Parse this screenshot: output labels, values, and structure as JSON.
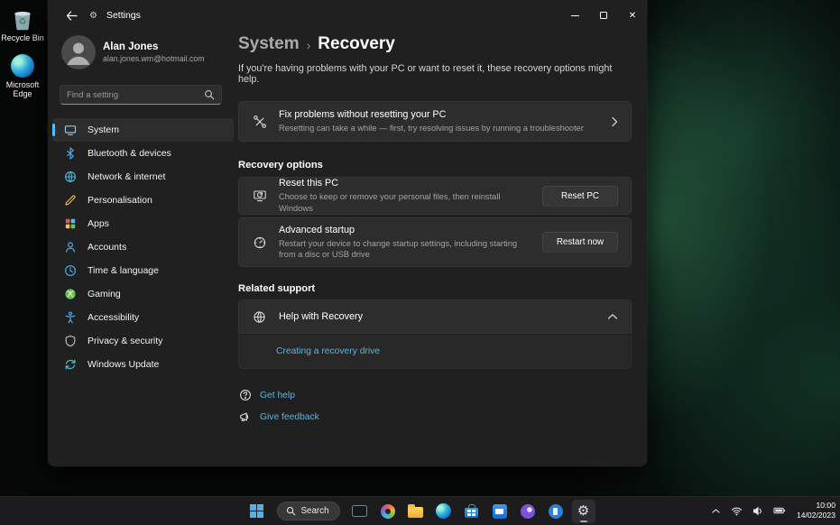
{
  "colors": {
    "accent": "#4cc2ff",
    "link": "#5fb4dc",
    "window_bg": "#202020",
    "card_bg": "#2d2d2d",
    "taskbar_bg": "#1d1d1f"
  },
  "desktop": {
    "icons": [
      {
        "label": "Recycle Bin",
        "icon": "recycle-bin-icon"
      },
      {
        "label": "Microsoft Edge",
        "icon": "edge-icon"
      }
    ]
  },
  "window": {
    "title": "Settings",
    "controls": {
      "minimize": "minimize",
      "maximize": "maximize",
      "close": "close"
    },
    "user": {
      "name": "Alan Jones",
      "email": "alan.jones.wm@hotmail.com"
    },
    "search": {
      "placeholder": "Find a setting",
      "icon": "search-icon"
    },
    "nav": [
      {
        "label": "System",
        "icon": "monitor-icon",
        "selected": true
      },
      {
        "label": "Bluetooth & devices",
        "icon": "bluetooth-icon"
      },
      {
        "label": "Network & internet",
        "icon": "globe-icon"
      },
      {
        "label": "Personalisation",
        "icon": "brush-icon"
      },
      {
        "label": "Apps",
        "icon": "apps-grid-icon"
      },
      {
        "label": "Accounts",
        "icon": "person-icon"
      },
      {
        "label": "Time & language",
        "icon": "clock-icon"
      },
      {
        "label": "Gaming",
        "icon": "xbox-icon"
      },
      {
        "label": "Accessibility",
        "icon": "accessibility-icon"
      },
      {
        "label": "Privacy & security",
        "icon": "shield-icon"
      },
      {
        "label": "Windows Update",
        "icon": "update-arrows-icon"
      }
    ],
    "page": {
      "breadcrumb_parent": "System",
      "breadcrumb_sep": "›",
      "breadcrumb_current": "Recovery",
      "intro": "If you're having problems with your PC or want to reset it, these recovery options might help.",
      "fix_card": {
        "icon": "tools-icon",
        "title": "Fix problems without resetting your PC",
        "subtitle": "Resetting can take a while — first, try resolving issues by running a troubleshooter"
      },
      "recovery_heading": "Recovery options",
      "reset_card": {
        "icon": "reset-pc-icon",
        "title": "Reset this PC",
        "subtitle": "Choose to keep or remove your personal files, then reinstall Windows",
        "button": "Reset PC"
      },
      "advanced_card": {
        "icon": "startup-gauge-icon",
        "title": "Advanced startup",
        "subtitle": "Restart your device to change startup settings, including starting from a disc or USB drive",
        "button": "Restart now"
      },
      "support_heading": "Related support",
      "help_card": {
        "icon": "help-globe-icon",
        "title": "Help with Recovery",
        "link": "Creating a recovery drive"
      },
      "get_help_label": "Get help",
      "give_feedback_label": "Give feedback"
    }
  },
  "taskbar": {
    "start": {
      "icon": "windows-start-icon"
    },
    "search_label": "Search",
    "apps": [
      {
        "icon": "terminal-icon"
      },
      {
        "icon": "photos-icon"
      },
      {
        "icon": "file-explorer-icon"
      },
      {
        "icon": "edge-icon"
      },
      {
        "icon": "store-icon"
      },
      {
        "icon": "mail-icon"
      },
      {
        "icon": "clipchamp-icon"
      },
      {
        "icon": "phone-link-icon"
      },
      {
        "icon": "settings-gear-icon",
        "active": true
      }
    ],
    "tray": {
      "icons": [
        "chevron-up-icon",
        "wifi-icon",
        "volume-icon",
        "battery-icon"
      ],
      "time": "10:00",
      "date": "14/02/2023"
    }
  }
}
